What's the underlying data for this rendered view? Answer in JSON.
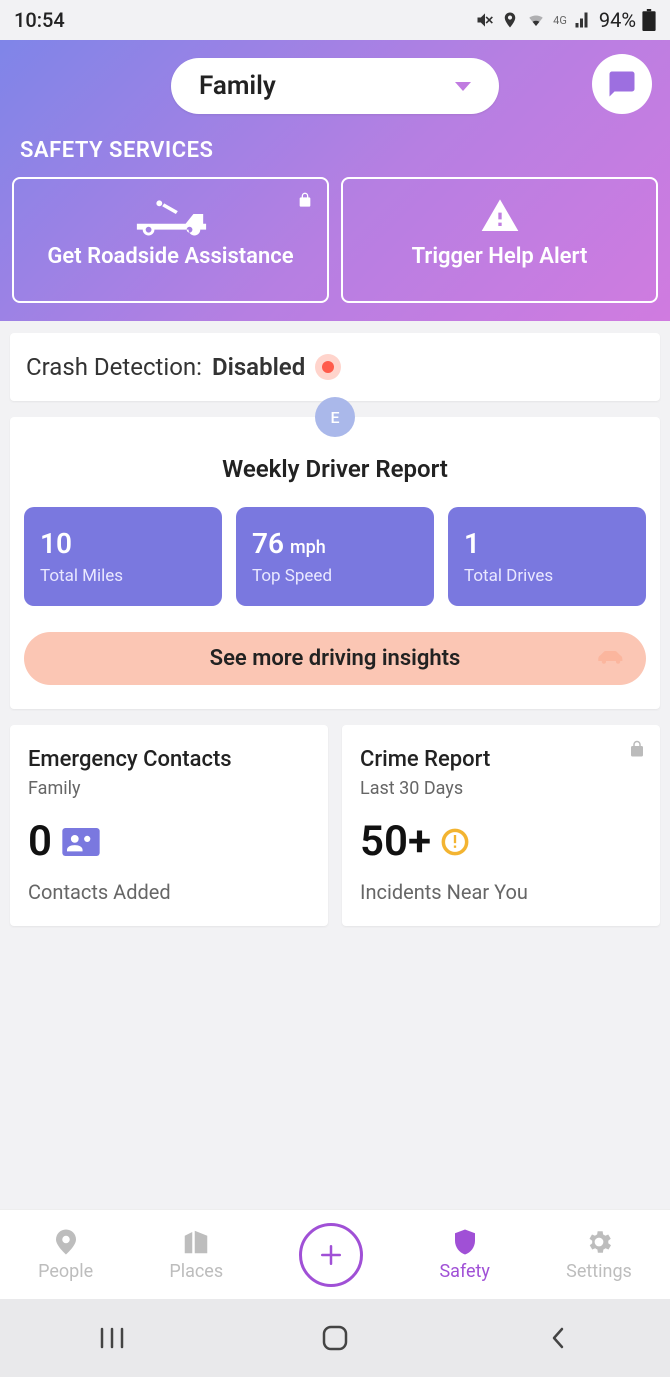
{
  "status": {
    "time": "10:54",
    "battery": "94%",
    "network": "4G"
  },
  "header": {
    "circle": "Family",
    "section": "SAFETY SERVICES"
  },
  "services": {
    "roadside": "Get Roadside Assistance",
    "help_alert": "Trigger Help Alert"
  },
  "crash": {
    "label": "Crash Detection:",
    "status": "Disabled"
  },
  "report": {
    "avatar": "E",
    "title": "Weekly Driver Report",
    "more": "See more driving insights",
    "stats": {
      "miles": {
        "value": "10",
        "label": "Total Miles"
      },
      "speed": {
        "value": "76",
        "unit": "mph",
        "label": "Top Speed"
      },
      "drives": {
        "value": "1",
        "label": "Total Drives"
      }
    }
  },
  "contacts": {
    "title": "Emergency Contacts",
    "sub": "Family",
    "count": "0",
    "foot": "Contacts Added"
  },
  "crime": {
    "title": "Crime Report",
    "sub": "Last 30 Days",
    "count": "50+",
    "foot": "Incidents Near You"
  },
  "tabs": {
    "people": "People",
    "places": "Places",
    "safety": "Safety",
    "settings": "Settings"
  }
}
